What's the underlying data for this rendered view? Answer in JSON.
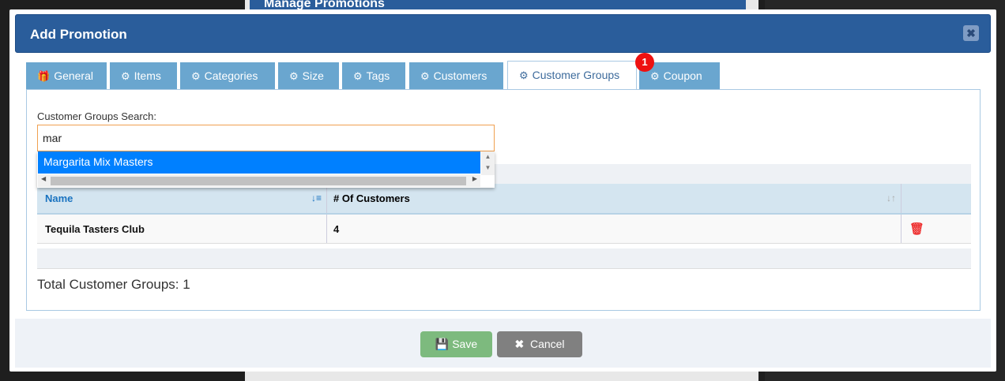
{
  "background": {
    "title": "Manage Promotions"
  },
  "modal": {
    "title": "Add Promotion",
    "close_icon": "close-icon"
  },
  "tabs": [
    {
      "label": "General",
      "icon": "gift-icon"
    },
    {
      "label": "Items",
      "icon": "gears-icon"
    },
    {
      "label": "Categories",
      "icon": "gears-icon"
    },
    {
      "label": "Size",
      "icon": "gears-icon"
    },
    {
      "label": "Tags",
      "icon": "gears-icon"
    },
    {
      "label": "Customers",
      "icon": "gears-icon"
    },
    {
      "label": "Customer Groups",
      "icon": "gears-icon",
      "active": true,
      "badge": "1"
    },
    {
      "label": "Coupon",
      "icon": "gears-icon"
    }
  ],
  "search": {
    "label": "Customer Groups Search:",
    "value": "mar",
    "suggestions": [
      "Margarita Mix Masters"
    ]
  },
  "table": {
    "columns": [
      "Name",
      "# Of Customers"
    ],
    "rows": [
      {
        "name": "Tequila Tasters Club",
        "count": "4"
      }
    ]
  },
  "total": "Total Customer Groups: 1",
  "footer": {
    "save": "Save",
    "cancel": "Cancel"
  },
  "colors": {
    "header": "#2a5d9b",
    "tab": "#6aa6cf",
    "save": "#7dba7e",
    "cancel": "#808080",
    "badge": "#ee1111"
  }
}
